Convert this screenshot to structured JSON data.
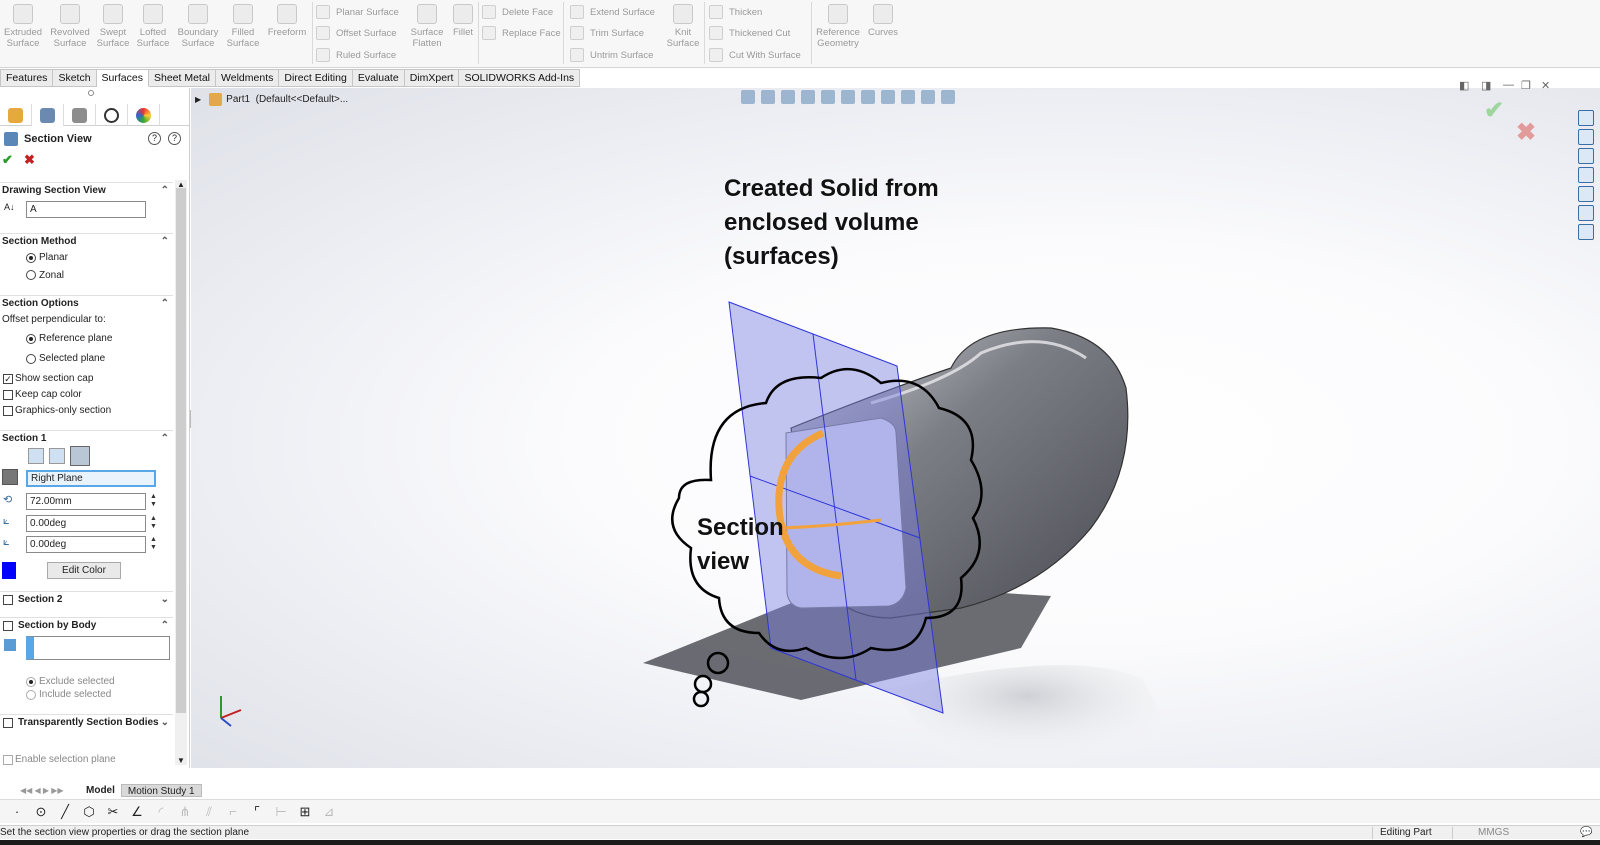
{
  "ribbon": {
    "big_buttons": [
      {
        "line1": "Extruded",
        "line2": "Surface",
        "icon": "extruded-surface-icon"
      },
      {
        "line1": "Revolved",
        "line2": "Surface",
        "icon": "revolved-surface-icon"
      },
      {
        "line1": "Swept",
        "line2": "Surface",
        "icon": "swept-surface-icon"
      },
      {
        "line1": "Lofted",
        "line2": "Surface",
        "icon": "lofted-surface-icon"
      },
      {
        "line1": "Boundary",
        "line2": "Surface",
        "icon": "boundary-surface-icon"
      },
      {
        "line1": "Filled",
        "line2": "Surface",
        "icon": "filled-surface-icon"
      },
      {
        "line1": "Freeform",
        "line2": "",
        "icon": "freeform-icon"
      }
    ],
    "col1": [
      "Planar Surface",
      "Offset Surface",
      "Ruled Surface"
    ],
    "flatten": {
      "line1": "Surface",
      "line2": "Flatten"
    },
    "fillet": "Fillet",
    "col2": [
      "Delete Face",
      "Replace Face"
    ],
    "col3": [
      "Extend Surface",
      "Trim Surface",
      "Untrim Surface"
    ],
    "knit": {
      "line1": "Knit",
      "line2": "Surface"
    },
    "col4": [
      "Thicken",
      "Thickened Cut",
      "Cut With Surface"
    ],
    "refgeom": {
      "line1": "Reference",
      "line2": "Geometry"
    },
    "curves": "Curves"
  },
  "tabs": [
    "Features",
    "Sketch",
    "Surfaces",
    "Sheet Metal",
    "Weldments",
    "Direct Editing",
    "Evaluate",
    "DimXpert",
    "SOLIDWORKS Add-Ins"
  ],
  "active_tab": "Surfaces",
  "property_manager": {
    "title": "Section View",
    "drawing_section_view": {
      "header": "Drawing Section View",
      "label_value": "A"
    },
    "section_method": {
      "header": "Section Method",
      "options": [
        "Planar",
        "Zonal"
      ],
      "selected": "Planar"
    },
    "section_options": {
      "header": "Section Options",
      "offset_label": "Offset perpendicular to:",
      "offset_options": [
        "Reference plane",
        "Selected plane"
      ],
      "offset_selected": "Reference plane",
      "show_section_cap": "Show section cap",
      "keep_cap_color": "Keep cap color",
      "graphics_only": "Graphics-only section"
    },
    "section1": {
      "header": "Section 1",
      "plane": "Right Plane",
      "offset": "72.00mm",
      "angle_x": "0.00deg",
      "angle_y": "0.00deg",
      "edit_color": "Edit Color",
      "color": "#0000ff"
    },
    "section2": {
      "header": "Section 2"
    },
    "section_by_body": {
      "header": "Section by Body",
      "exclude": "Exclude selected",
      "include": "Include selected"
    },
    "transparently": {
      "header": "Transparently Section Bodies"
    },
    "enable_selection_plane": "Enable selection plane"
  },
  "feature_tree": {
    "part": "Part1",
    "config": "(Default<<Default>..."
  },
  "annotations": {
    "main": "Created Solid from\nenclosed volume\n(surfaces)",
    "bubble": "Section\nview"
  },
  "bottom_tabs": {
    "model": "Model",
    "motion": "Motion Study 1"
  },
  "status": {
    "message": "Set the section view properties or drag the section plane",
    "mode": "Editing Part",
    "units": "MMGS"
  },
  "colors": {
    "plane": "#7a7fe0",
    "section": "#f2a23c",
    "accent_blue": "#0000ff"
  }
}
